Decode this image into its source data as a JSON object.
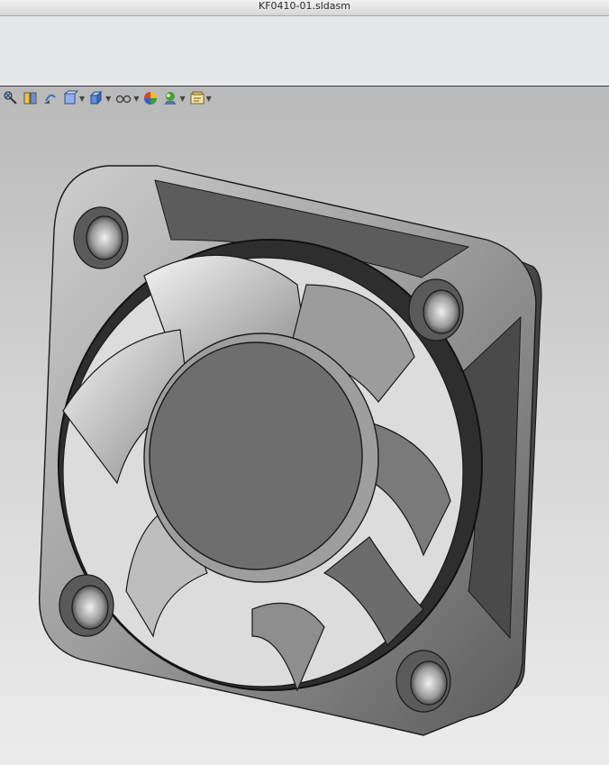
{
  "window": {
    "title": "KF0410-01.sldasm"
  },
  "heads_up_toolbar": {
    "tools": [
      {
        "icon": "zoom-to-fit-icon",
        "has_dropdown": false
      },
      {
        "icon": "zoom-to-area-icon",
        "has_dropdown": false
      },
      {
        "icon": "previous-view-icon",
        "has_dropdown": false
      },
      {
        "icon": "section-view-icon",
        "has_dropdown": true
      },
      {
        "icon": "view-orientation-icon",
        "has_dropdown": true
      },
      {
        "icon": "hide-show-items-icon",
        "has_dropdown": true
      },
      {
        "icon": "edit-appearance-icon",
        "has_dropdown": false
      },
      {
        "icon": "apply-scene-icon",
        "has_dropdown": true
      },
      {
        "icon": "view-settings-icon",
        "has_dropdown": true
      }
    ]
  },
  "model": {
    "name": "axial-fan-assembly"
  },
  "colors": {
    "viewport_top": "#b9b9b9",
    "viewport_bottom": "#ececec",
    "housing": "#8c8c8c",
    "hub": "#6e6e6e",
    "edge": "#1a1a1a"
  }
}
